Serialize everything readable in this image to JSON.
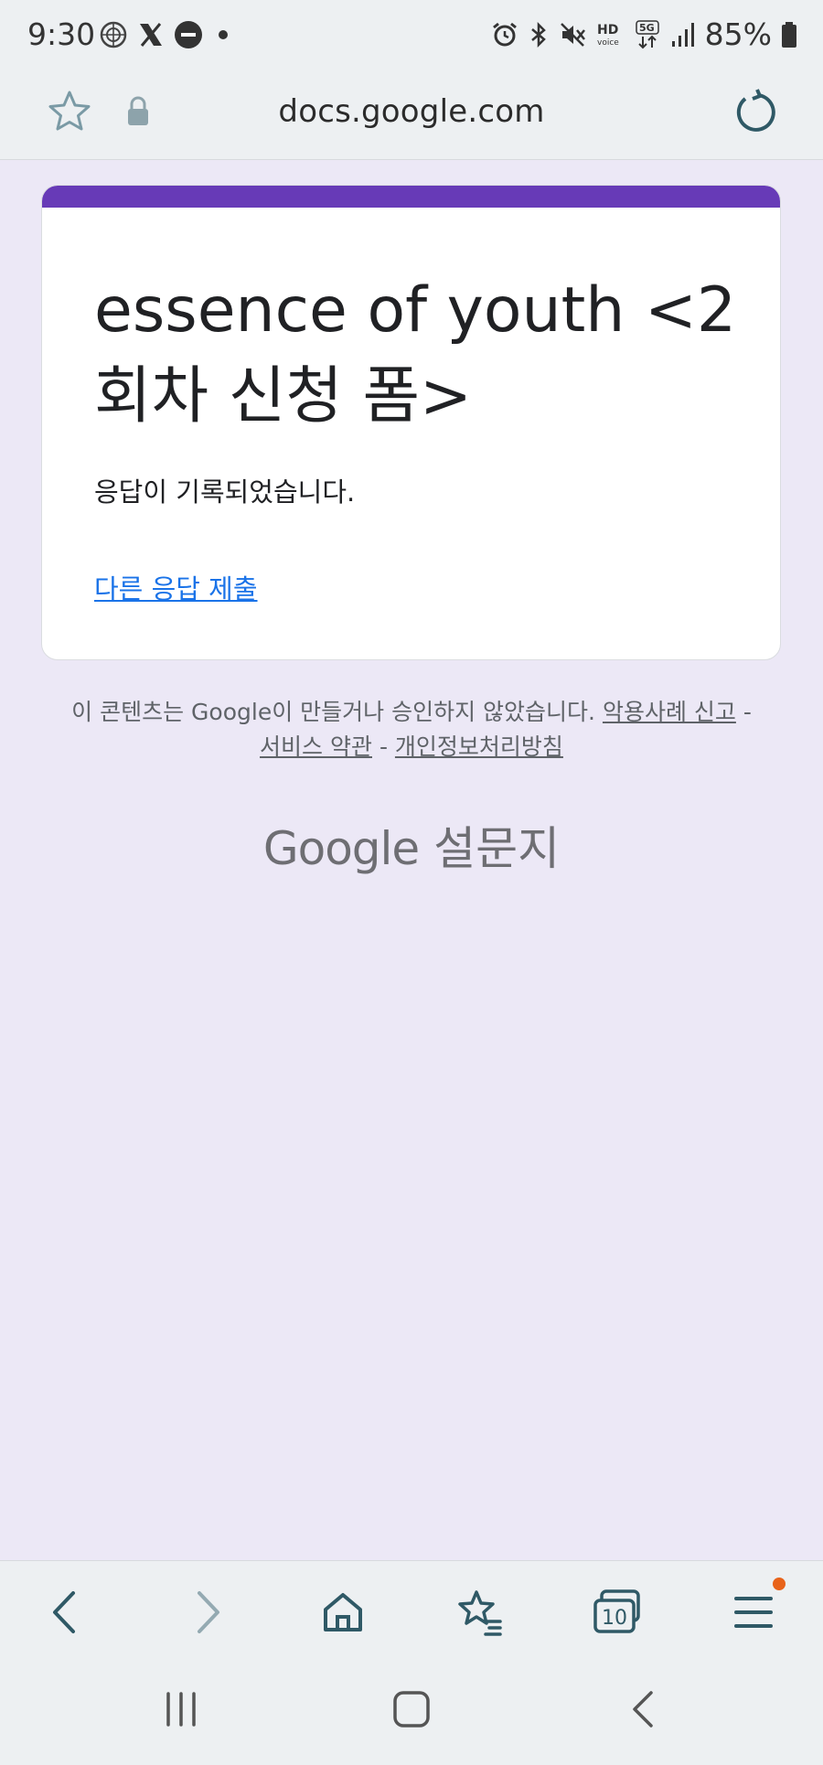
{
  "status_bar": {
    "time": "9:30",
    "battery_percent": "85%",
    "left_icons": [
      "vpn-globe-icon",
      "x-icon",
      "do-not-disturb-icon",
      "dot-icon"
    ],
    "right_icons": [
      "alarm-icon",
      "bluetooth-icon",
      "mute-icon",
      "hd-voice-icon",
      "5g-icon",
      "signal-icon",
      "battery-icon"
    ]
  },
  "browser": {
    "url": "docs.google.com",
    "tab_count": "10"
  },
  "form": {
    "title": "essence of youth <2회차 신청 폼>",
    "confirmation": "응답이 기록되었습니다.",
    "another_response_link": "다른 응답 제출"
  },
  "footer": {
    "disclaimer_text": "이 콘텐츠는 Google이 만들거나 승인하지 않았습니다. ",
    "report_abuse": "악용사례 신고",
    "sep1": " - ",
    "terms": "서비스 약관",
    "sep2": " - ",
    "privacy": "개인정보처리방침",
    "brand_google": "Google",
    "brand_forms": " 설문지"
  },
  "colors": {
    "accent_purple": "#673ab7",
    "link_blue": "#1a73e8",
    "page_background": "#ece8f6",
    "menu_badge": "#e8631a"
  }
}
